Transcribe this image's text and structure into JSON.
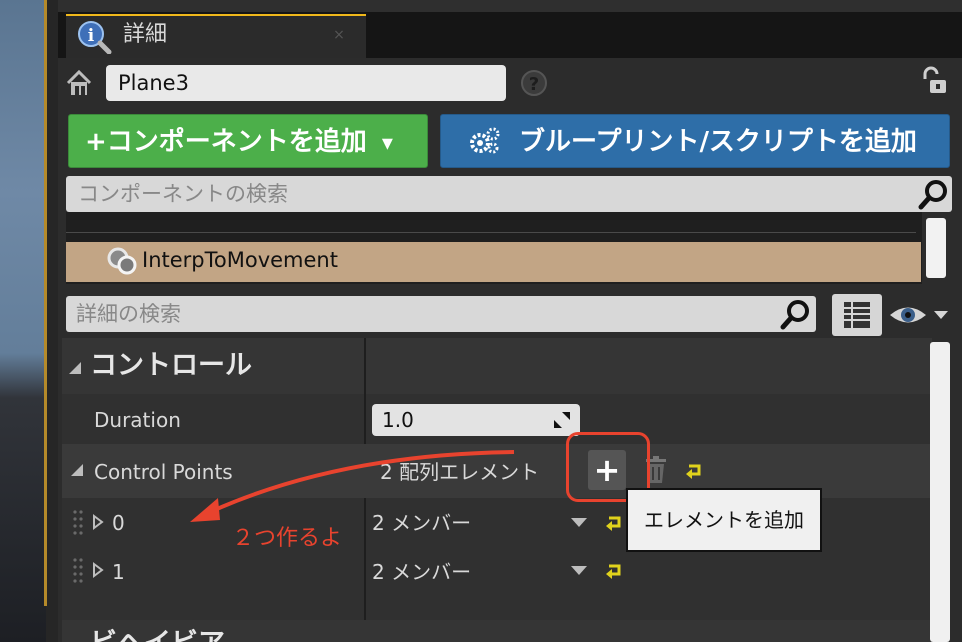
{
  "tab": {
    "title": "詳細",
    "close": "×"
  },
  "object": {
    "name": "Plane3",
    "help": "?"
  },
  "buttons": {
    "add_component": "+コンポーネントを追加",
    "add_component_caret": "▾",
    "add_blueprint": "ブループリント/スクリプトを追加"
  },
  "component_search": {
    "placeholder": "コンポーネントの検索"
  },
  "component_tree": {
    "selected": "InterpToMovement"
  },
  "details_search": {
    "placeholder": "詳細の検索"
  },
  "category": {
    "title": "コントロール",
    "next_title": "ビヘイビア"
  },
  "properties": {
    "duration": {
      "label": "Duration",
      "value": "1.0"
    },
    "control_points": {
      "label": "Control Points",
      "value": "2 配列エレメント"
    },
    "items": [
      {
        "label": "0",
        "value": "2 メンバー"
      },
      {
        "label": "1",
        "value": "2 メンバー"
      }
    ]
  },
  "tooltip": "エレメントを追加",
  "annotation": "２つ作るよ",
  "colors": {
    "add_component": "#4caf4a",
    "add_blueprint": "#2e6ea8",
    "selected_row": "#c2a585",
    "annotation": "#e8432e",
    "tab_accent": "#f0b81b",
    "reset_arrow": "#e0d21c"
  }
}
